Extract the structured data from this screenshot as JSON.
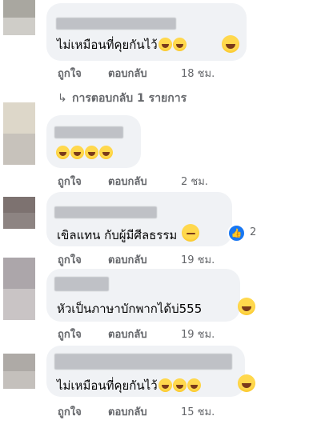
{
  "comments": [
    {
      "text": "ไม่เหมือนที่คุยกันไว้",
      "like": "ถูกใจ",
      "reply": "ตอบกลับ",
      "time": "18 ชม."
    },
    {
      "text": "",
      "like": "ถูกใจ",
      "reply": "ตอบกลับ",
      "time": "2 ชม."
    },
    {
      "text": "เขิลแทน กับผู้มีศีลธรรม",
      "like": "ถูกใจ",
      "reply": "ตอบกลับ",
      "time": "19 ชม.",
      "reaction_count": "2"
    },
    {
      "text": "หัวเป็นภาษาบักพากได้บ่555",
      "like": "ถูกใจ",
      "reply": "ตอบกลับ",
      "time": "19 ชม."
    },
    {
      "text": "ไม่เหมือนที่คุยกันไว้",
      "like": "ถูกใจ",
      "reply": "ตอบกลับ",
      "time": "15 ชม."
    }
  ],
  "replies_link": "การตอบกลับ 1 รายการ",
  "icons": {
    "reply_arrow": "↳",
    "like_reaction": "thumbs-up-icon"
  },
  "colors": {
    "bubble": "#f0f2f5",
    "meta": "#65676b",
    "like_blue": "#1877f2"
  }
}
